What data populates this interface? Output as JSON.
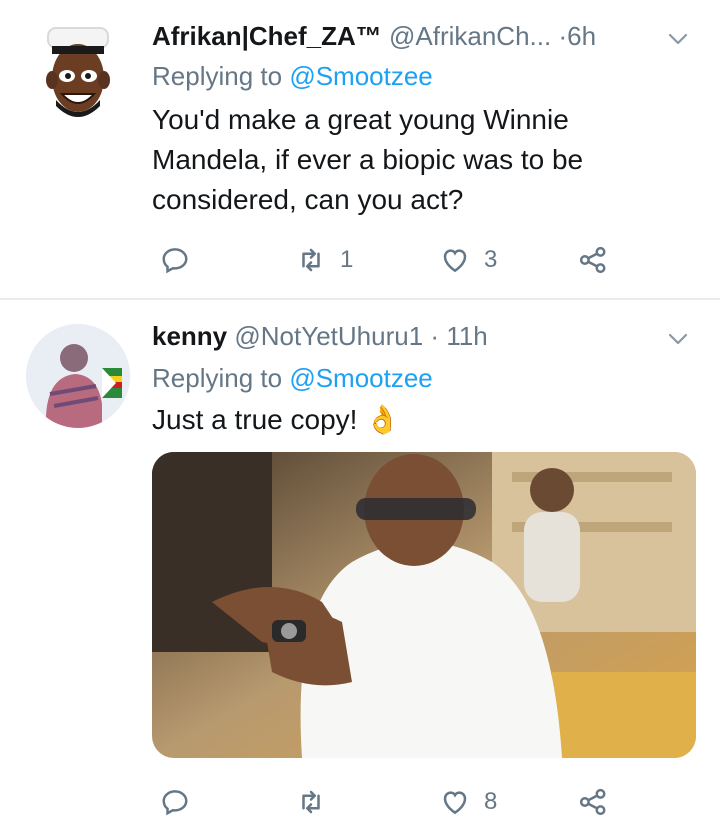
{
  "tweets": [
    {
      "name": "Afrikan|Chef_ZA™",
      "handle": "@AfrikanCh...",
      "separator": "·",
      "time": "6h",
      "replying_prefix": "Replying to",
      "replying_to": "@Smootzee",
      "text_lines": [
        "You'd make a great young Winnie",
        "Mandela, if ever a biopic was to be",
        "considered, can you act?"
      ],
      "actions": {
        "reply_count": "",
        "retweet_count": "1",
        "like_count": "3"
      }
    },
    {
      "name": "kenny",
      "handle": "@NotYetUhuru1",
      "separator": "·",
      "time": "11h",
      "replying_prefix": "Replying to",
      "replying_to": "@Smootzee",
      "text_lines": [
        "Just a true copy! 👌"
      ],
      "actions": {
        "reply_count": "",
        "retweet_count": "",
        "like_count": "8"
      }
    }
  ],
  "icons": {
    "reply": "reply-icon",
    "retweet": "retweet-icon",
    "like": "heart-icon",
    "share": "share-icon",
    "caret": "chevron-down-icon"
  },
  "colors": {
    "text_primary": "#14171a",
    "text_secondary": "#657786",
    "accent": "#1da1f2",
    "divider": "#e6ecf0"
  }
}
